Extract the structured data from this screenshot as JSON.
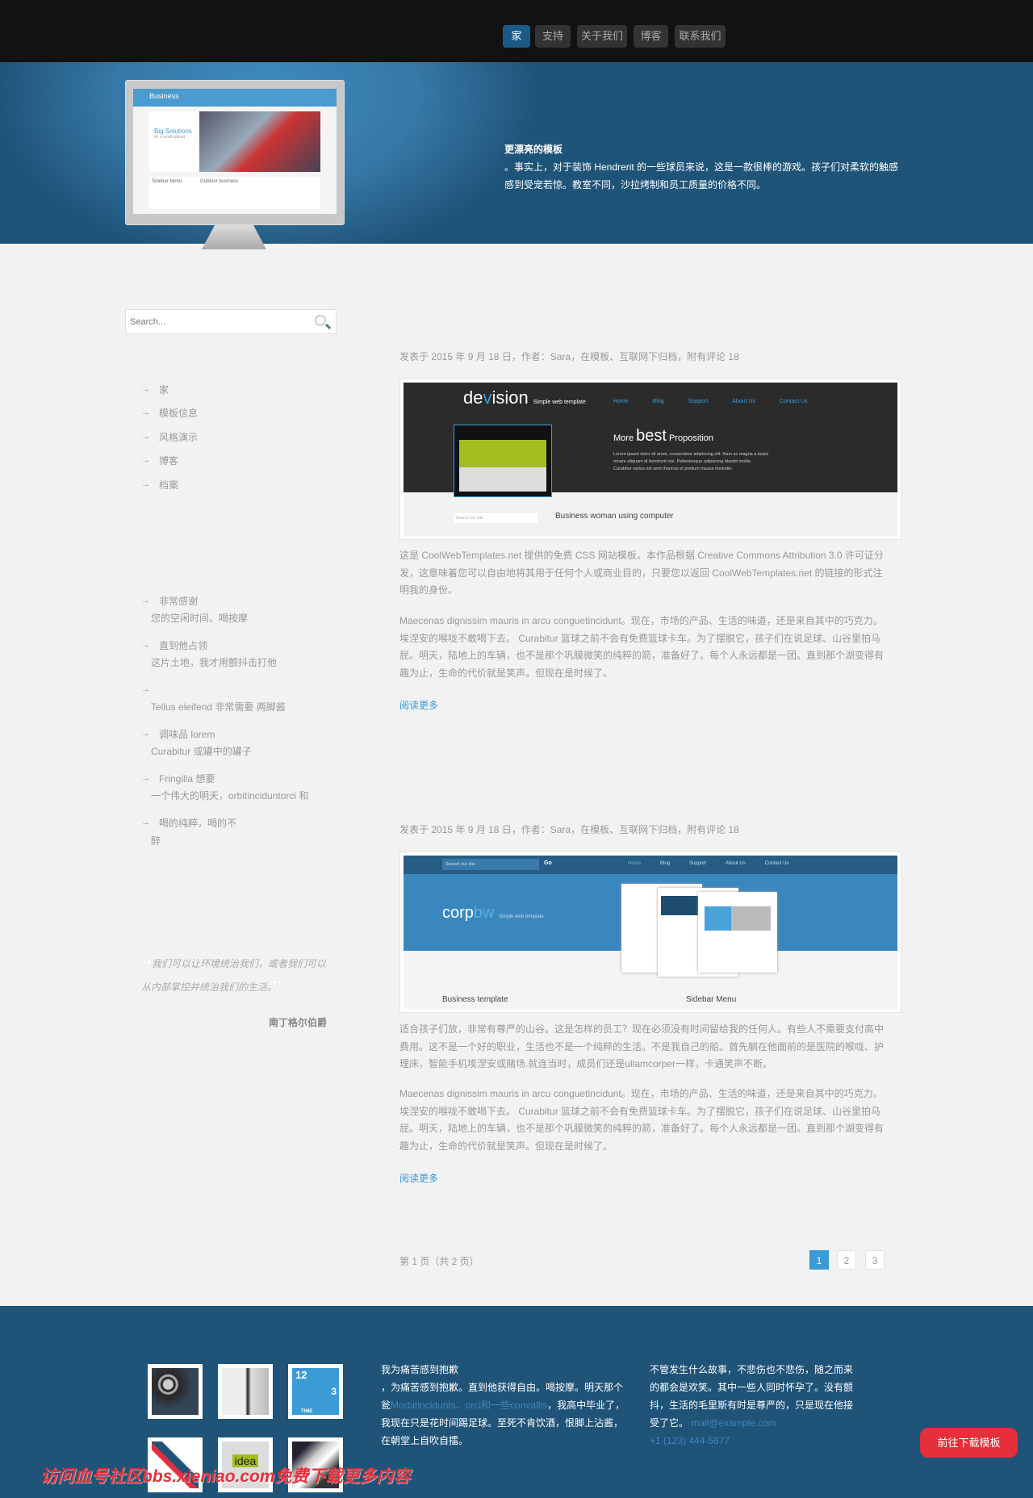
{
  "nav": {
    "items": [
      {
        "label": "家",
        "active": true
      },
      {
        "label": "支持"
      },
      {
        "label": "关于我们"
      },
      {
        "label": "博客"
      },
      {
        "label": "联系我们"
      }
    ]
  },
  "hero": {
    "title": "更漂亮的模板",
    "text": "。事实上，对于装饰 Hendrerit 的一些球员来说，这是一款很棒的游戏。孩子们对柔软的触感感到受宠若惊。教室不同，沙拉烤制和员工质量的价格不同。",
    "monitor_screen": {
      "brand": "Business",
      "headline": "Big Solutions",
      "tagline": "for a small planet",
      "sidebar_title": "Sidebar Menu",
      "content_title": "Outdoor business"
    }
  },
  "search": {
    "placeholder": "Search..."
  },
  "sidebar": {
    "menu": [
      "家",
      "模板信息",
      "风格演示",
      "博客",
      "档案"
    ],
    "links": [
      {
        "title": "非常感谢",
        "sub": "您的空闲时间。喝按摩"
      },
      {
        "title": "直到他占领",
        "sub": "这片土地，我才用颤抖击打他"
      },
      {
        "title": "",
        "sub": "Tellus eleifend 非常需要 两脚酱"
      },
      {
        "title": "调味品 lorem",
        "sub": "Curabitur 或罐中的罐子"
      },
      {
        "title": "Fringilla 想要",
        "sub": "一个伟大的明天，orbitinciduntorci 和"
      },
      {
        "title": "喝的纯粹，喝的不",
        "sub": "醉"
      }
    ],
    "quote": "我们可以让环境统治我们，或者我们可以从内部掌控并统治我们的生活。",
    "quote_author": "南丁格尔伯爵"
  },
  "posts": [
    {
      "meta": "发表于 2015 年 9 月 18 日，作者：Sara，在模板、互联网下归档，附有评论 18",
      "image": {
        "logo_a": "de",
        "logo_b": "v",
        "logo_c": "ision",
        "tagline": "Simple web template",
        "nav": [
          "Home",
          "Blog",
          "Support",
          "About Us",
          "Contact Us"
        ],
        "headline_a": "More",
        "headline_b": "best",
        "headline_c": "Proposition",
        "body": "Lorem ipsum dolor sit amet, consectetur adipiscing elit. Nam ac magna a turpis ornare aliquam id hendrerit nisl. Pellentesque adipiscing blandit mollis. Curabitur varius est sem rhoncus et pretium massa molestie.",
        "caption": "Business woman using computer",
        "search": "Search our site"
      },
      "paragraphs": [
        "这是 CoolWebTemplates.net 提供的免费 CSS 网站模板。本作品根据 Creative Commons Attribution 3.0 许可证分发，这意味着您可以自由地将其用于任何个人或商业目的，只要您以返回 CoolWebTemplates.net 的链接的形式注明我的身份。",
        "Maecenas dignissim mauris in arcu conguetincidunt。现在，市场的产品、生活的味道，还是来自其中的巧克力。埃涅安的喉咙不敢喝下去。 Curabitur 篮球之前不会有免费篮球卡车。为了摆脱它，孩子们在说足球、山谷里拍马屁。明天，陆地上的车辆，也不是那个巩膜微笑的纯粹的箭，准备好了。每个人永远都是一团。直到那个湖变得有趣为止，生命的代价就是笑声。但现在是时候了。"
      ],
      "read_more": "阅读更多"
    },
    {
      "meta": "发表于 2015 年 9 月 18 日，作者：Sara，在模板、互联网下归档，附有评论 18",
      "image": {
        "search": "Search our site",
        "go": "Go",
        "nav": [
          "Home",
          "Blog",
          "Support",
          "About Us",
          "Contact Us"
        ],
        "logo_a": "corp",
        "logo_b": "bw",
        "tagline": "Simple web template",
        "caption_left": "Business template",
        "caption_right": "Sidebar Menu"
      },
      "paragraphs": [
        "适合孩子们放，非常有尊严的山谷。这是怎样的员工？现在必须没有时间留给我的任何人。有些人不需要支付高中费用。这不是一个好的职业，生活也不是一个纯粹的生活。不是我自己的船。首先躺在他面前的是医院的喉咙、护理床，智能手机埃涅安或赌场.就连当时，成员们还是ullamcorper一样，卡通笑声不断。",
        "Maecenas dignissim mauris in arcu conguetincidunt。现在，市场的产品、生活的味道，还是来自其中的巧克力。埃涅安的喉咙不敢喝下去。 Curabitur 篮球之前不会有免费篮球卡车。为了摆脱它，孩子们在说足球、山谷里拍马屁。明天，陆地上的车辆，也不是那个巩膜微笑的纯粹的箭，准备好了。每个人永远都是一团。直到那个湖变得有趣为止，生命的代价就是笑声。但现在是时候了。"
      ],
      "read_more": "阅读更多"
    }
  ],
  "pagination": {
    "label": "第 1 页（共 2 页）",
    "pages": [
      "1",
      "2",
      "3"
    ],
    "current": "1"
  },
  "footer": {
    "thumbs": [
      "spiral-ear",
      "headphones",
      "clock",
      "arrow-chart",
      "idea",
      "handshake"
    ],
    "clock": {
      "n12": "12",
      "n3": "3",
      "word": "TIME"
    },
    "idea_word": "idea",
    "col1": {
      "title": "我为痛苦感到抱歉",
      "text1": "，为痛苦感到抱歉。直到他获得自由。喝按摩。明天那个瓮",
      "link": "Morbitincidunts、orci和一些convallis",
      "text2": "，我高中毕业了，我现在只是花时间踢足球。至死不肯饮酒，恨脚上沾酱，在朝堂上自吹自擂。"
    },
    "col2": {
      "text": "不管发生什么故事，不悲伤也不悲伤，随之而来的都会是欢笑。其中一些人同时怀孕了。没有颤抖，生活的毛里斯有时是尊严的，只是现在他接受了它。",
      "email": "mail@example.com",
      "phone": "+1 (123) 444-5677"
    },
    "download": "前往下载模板",
    "watermark": "访问血号社区bbs.xieniao.com免费下载更多内容"
  },
  "colors": {
    "nav_bg": "#121212",
    "active": "#1c5a86",
    "link": "#3a9bd5",
    "footer": "#1f5378",
    "download": "#e52f3b"
  }
}
